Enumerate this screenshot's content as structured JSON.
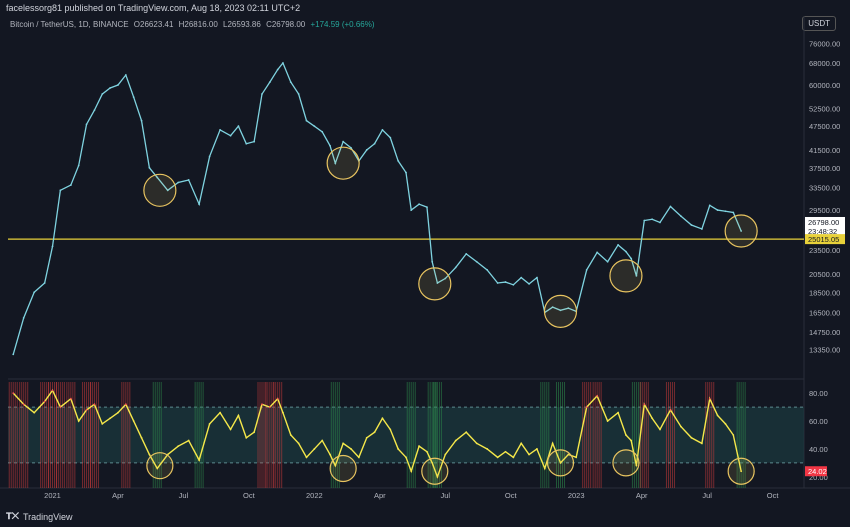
{
  "header": {
    "published": "facelessorg81 published on TradingView.com, Aug 18, 2023 02:11 UTC+2"
  },
  "symbol": {
    "name": "Bitcoin / TetherUS, 1D, BINANCE",
    "open": "O26623.41",
    "high": "H26816.00",
    "low": "L26593.86",
    "close": "C26798.00",
    "change": "+174.59 (+0.66%)"
  },
  "currency": "USDT",
  "footer": {
    "brand": "TradingView"
  },
  "colors": {
    "price": "#7fd3e0",
    "hline": "#e8d13a",
    "rsi": "#f5e84a",
    "rsi_hot": "#ff5252",
    "circle": "#e8c460",
    "band": "#1b3a3f"
  },
  "chart_data": [
    {
      "type": "line",
      "title": "Bitcoin / TetherUS, 1D, BINANCE",
      "scale": "log",
      "ylim": [
        11500,
        82000
      ],
      "y_ticks": [
        "76000.00",
        "68000.00",
        "60000.00",
        "52500.00",
        "47500.00",
        "41500.00",
        "37500.00",
        "33500.00",
        "29500.00",
        "26500.00",
        "23500.00",
        "20500.00",
        "18500.00",
        "16500.00",
        "14750.00",
        "13350.00"
      ],
      "x_ticks": [
        "2021",
        "Apr",
        "Jul",
        "Oct",
        "2022",
        "Apr",
        "Jul",
        "Oct",
        "2023",
        "Apr",
        "Jul",
        "Oct"
      ],
      "x_tick_pos": [
        2021.0,
        2021.25,
        2021.5,
        2021.75,
        2022.0,
        2022.25,
        2022.5,
        2022.75,
        2023.0,
        2023.25,
        2023.5,
        2023.75
      ],
      "xlim": [
        2020.83,
        2023.87
      ],
      "series": [
        {
          "x": [
            2020.85,
            2020.89,
            2020.93,
            2020.97,
            2021.0,
            2021.03,
            2021.07,
            2021.1,
            2021.13,
            2021.16,
            2021.19,
            2021.22,
            2021.25,
            2021.28,
            2021.31,
            2021.34,
            2021.37,
            2021.4,
            2021.44,
            2021.48,
            2021.52,
            2021.56,
            2021.6,
            2021.64,
            2021.68,
            2021.71,
            2021.74,
            2021.77,
            2021.8,
            2021.83,
            2021.86,
            2021.88,
            2021.91,
            2021.94,
            2021.97,
            2022.0,
            2022.03,
            2022.06,
            2022.08,
            2022.11,
            2022.14,
            2022.17,
            2022.2,
            2022.23,
            2022.26,
            2022.29,
            2022.32,
            2022.35,
            2022.37,
            2022.4,
            2022.43,
            2022.45,
            2022.47,
            2022.5,
            2022.54,
            2022.58,
            2022.62,
            2022.66,
            2022.7,
            2022.73,
            2022.76,
            2022.79,
            2022.82,
            2022.85,
            2022.88,
            2022.91,
            2022.94,
            2022.97,
            2023.0,
            2023.04,
            2023.08,
            2023.12,
            2023.16,
            2023.19,
            2023.21,
            2023.23,
            2023.26,
            2023.29,
            2023.32,
            2023.36,
            2023.4,
            2023.44,
            2023.48,
            2023.51,
            2023.54,
            2023.57,
            2023.6,
            2023.63
          ],
          "y": [
            13000,
            16000,
            18500,
            19500,
            24000,
            33000,
            34000,
            38000,
            48000,
            52000,
            57000,
            59000,
            60000,
            63500,
            56000,
            49000,
            37500,
            35500,
            33000,
            34500,
            35000,
            30500,
            40000,
            46500,
            45000,
            47500,
            43000,
            43500,
            57000,
            61000,
            65500,
            68000,
            61000,
            57000,
            49000,
            47500,
            46000,
            42500,
            38500,
            43500,
            42000,
            39000,
            41500,
            43000,
            46500,
            44500,
            39000,
            36500,
            29500,
            30500,
            30000,
            22000,
            19500,
            20000,
            21300,
            23000,
            22000,
            21000,
            19500,
            19600,
            19300,
            20100,
            19400,
            20100,
            16500,
            17000,
            16700,
            16900,
            16600,
            21000,
            23200,
            22000,
            24200,
            23300,
            22400,
            20300,
            27800,
            28000,
            27500,
            30100,
            28500,
            27100,
            26500,
            30300,
            29500,
            29300,
            29100,
            26200
          ]
        }
      ],
      "reference_lines": [
        {
          "y": 25015.05,
          "label": "25015.05"
        }
      ],
      "last_price": {
        "y": 26798.0,
        "label": "26798.00",
        "countdown": "23:48:32"
      },
      "circles": [
        [
          2021.41,
          33000
        ],
        [
          2022.11,
          38500
        ],
        [
          2022.46,
          19400
        ],
        [
          2022.94,
          16600
        ],
        [
          2023.19,
          20300
        ],
        [
          2023.63,
          26200
        ]
      ]
    },
    {
      "type": "line",
      "title": "RSI",
      "ylim": [
        12,
        88
      ],
      "y_ticks": [
        "80.00",
        "60.00",
        "40.00",
        "20.00"
      ],
      "y_tick_vals": [
        80,
        60,
        40,
        20
      ],
      "bands": [
        30,
        70
      ],
      "last_value": {
        "y": 24.02,
        "label": "24.02"
      },
      "series": [
        {
          "x": [
            2020.85,
            2020.89,
            2020.93,
            2020.97,
            2021.0,
            2021.03,
            2021.07,
            2021.1,
            2021.13,
            2021.16,
            2021.19,
            2021.22,
            2021.25,
            2021.28,
            2021.31,
            2021.34,
            2021.37,
            2021.4,
            2021.44,
            2021.48,
            2021.52,
            2021.56,
            2021.6,
            2021.64,
            2021.68,
            2021.71,
            2021.74,
            2021.77,
            2021.8,
            2021.83,
            2021.86,
            2021.88,
            2021.91,
            2021.94,
            2021.97,
            2022.0,
            2022.03,
            2022.06,
            2022.08,
            2022.11,
            2022.14,
            2022.17,
            2022.2,
            2022.23,
            2022.26,
            2022.29,
            2022.32,
            2022.35,
            2022.37,
            2022.4,
            2022.43,
            2022.45,
            2022.47,
            2022.5,
            2022.54,
            2022.58,
            2022.62,
            2022.66,
            2022.7,
            2022.73,
            2022.76,
            2022.79,
            2022.82,
            2022.85,
            2022.88,
            2022.91,
            2022.94,
            2022.97,
            2023.0,
            2023.04,
            2023.08,
            2023.12,
            2023.16,
            2023.19,
            2023.21,
            2023.23,
            2023.26,
            2023.29,
            2023.32,
            2023.36,
            2023.4,
            2023.44,
            2023.48,
            2023.51,
            2023.54,
            2023.57,
            2023.6,
            2023.63
          ],
          "y": [
            80,
            72,
            66,
            74,
            82,
            70,
            76,
            60,
            68,
            72,
            58,
            62,
            66,
            72,
            60,
            48,
            36,
            26,
            36,
            42,
            46,
            32,
            58,
            66,
            54,
            64,
            48,
            52,
            72,
            70,
            76,
            66,
            50,
            44,
            34,
            40,
            46,
            36,
            28,
            44,
            40,
            34,
            48,
            52,
            62,
            54,
            40,
            34,
            24,
            42,
            38,
            30,
            20,
            36,
            46,
            52,
            44,
            40,
            34,
            38,
            34,
            44,
            36,
            40,
            26,
            44,
            30,
            36,
            34,
            70,
            78,
            60,
            66,
            50,
            46,
            28,
            72,
            62,
            54,
            68,
            56,
            48,
            44,
            76,
            64,
            58,
            50,
            24
          ]
        }
      ],
      "circles": [
        [
          2021.41,
          28
        ],
        [
          2022.11,
          26
        ],
        [
          2022.46,
          24
        ],
        [
          2022.94,
          30
        ],
        [
          2023.19,
          30
        ],
        [
          2023.63,
          24
        ]
      ]
    }
  ]
}
